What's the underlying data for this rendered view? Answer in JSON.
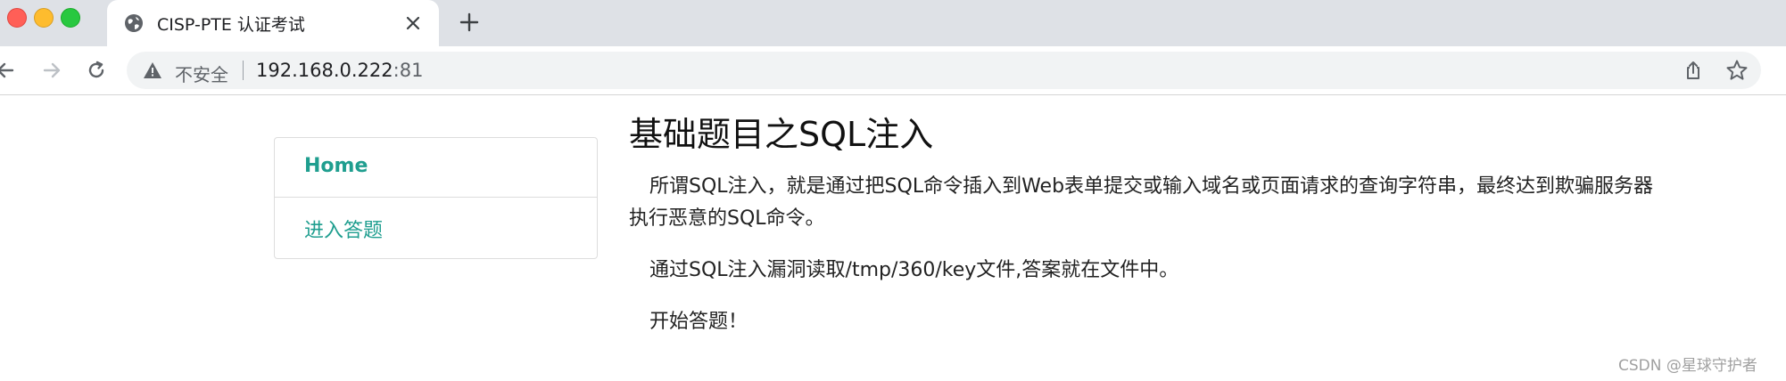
{
  "browser": {
    "tab_title": "CISP-PTE 认证考试",
    "insecure_label": "不安全",
    "url_host": "192.168.0.222",
    "url_port": ":81",
    "icons": [
      "globe-icon",
      "tab-close-icon",
      "new-tab-icon",
      "back-arrow-icon",
      "forward-arrow-icon",
      "reload-icon",
      "warning-icon",
      "share-icon",
      "star-icon"
    ]
  },
  "sidebar": {
    "items": [
      {
        "label": "Home"
      },
      {
        "label": "进入答题"
      }
    ],
    "accent_color": "#1f9e8f"
  },
  "main": {
    "title": "基础题目之SQL注入",
    "paragraphs": [
      "所谓SQL注入，就是通过把SQL命令插入到Web表单提交或输入域名或页面请求的查询字符串，最终达到欺骗服务器执行恶意的SQL命令。",
      "通过SQL注入漏洞读取/tmp/360/key文件,答案就在文件中。",
      "开始答题！"
    ]
  },
  "watermark": "CSDN @星球守护者"
}
